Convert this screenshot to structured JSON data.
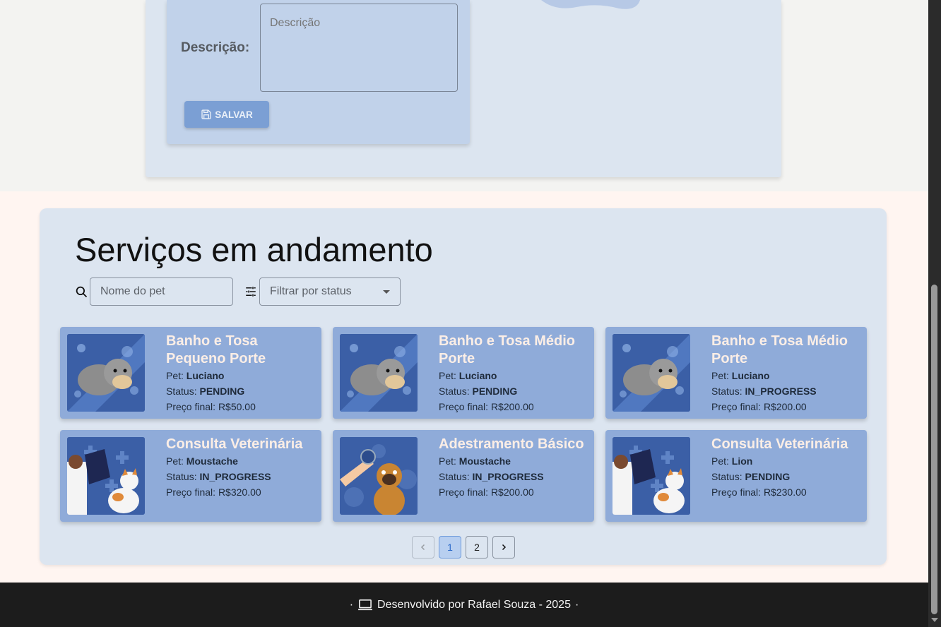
{
  "form": {
    "description_label": "Descrição:",
    "description_placeholder": "Descrição",
    "save_label": "SALVAR"
  },
  "services": {
    "title": "Serviços em andamento",
    "search_placeholder": "Nome do pet",
    "status_filter_placeholder": "Filtrar por status",
    "pet_label": "Pet:",
    "status_label": "Status:",
    "price_label": "Preço final:",
    "cards": [
      {
        "title": "Banho e Tosa Pequeno Porte",
        "pet": "Luciano",
        "status": "PENDING",
        "price": "R$50.00",
        "image": "dog-bath"
      },
      {
        "title": "Banho e Tosa Médio Porte",
        "pet": "Luciano",
        "status": "PENDING",
        "price": "R$200.00",
        "image": "dog-bath"
      },
      {
        "title": "Banho e Tosa Médio Porte",
        "pet": "Luciano",
        "status": "IN_PROGRESS",
        "price": "R$200.00",
        "image": "dog-bath"
      },
      {
        "title": "Consulta Veterinária",
        "pet": "Moustache",
        "status": "IN_PROGRESS",
        "price": "R$320.00",
        "image": "vet-cat"
      },
      {
        "title": "Adestramento Básico",
        "pet": "Moustache",
        "status": "IN_PROGRESS",
        "price": "R$200.00",
        "image": "dog-training"
      },
      {
        "title": "Consulta Veterinária",
        "pet": "Lion",
        "status": "PENDING",
        "price": "R$230.00",
        "image": "vet-cat"
      }
    ],
    "pagination": {
      "pages": [
        "1",
        "2"
      ],
      "current": "1"
    }
  },
  "footer": {
    "separator": "·",
    "text": "Desenvolvido por Rafael Souza - 2025"
  },
  "colors": {
    "card_bg": "#8fabd9",
    "card_title": "#fbeee6",
    "panel_bg": "#dce5f0",
    "button_bg": "#7b9fd4"
  }
}
